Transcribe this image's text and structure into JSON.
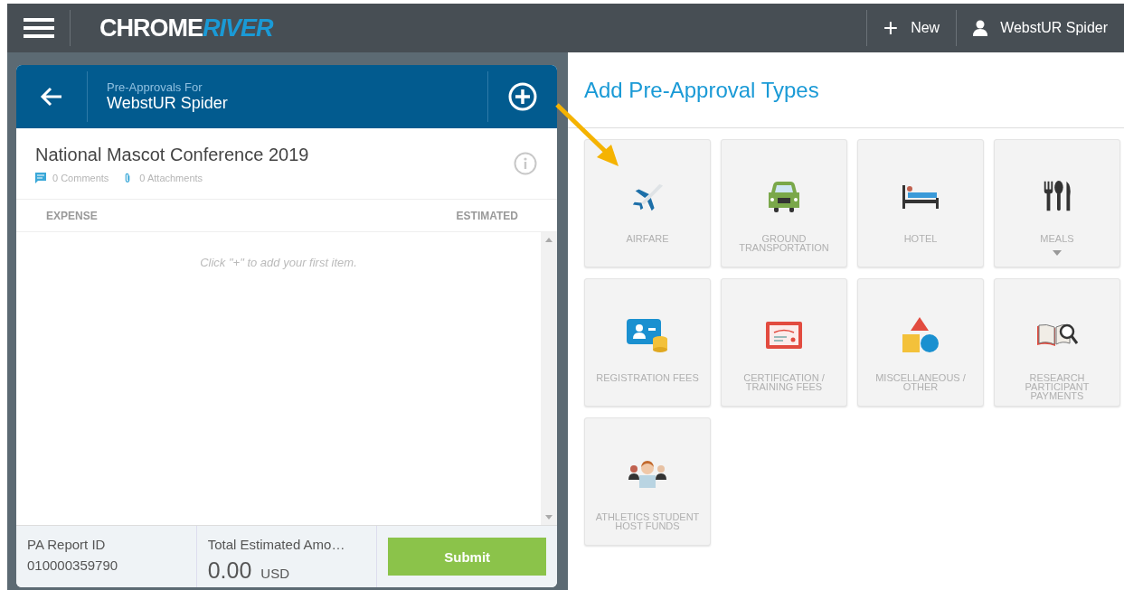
{
  "top_bar": {
    "logo": {
      "part_1": "CHROME",
      "part_2": "RIVER"
    },
    "new_button": {
      "icon": "+",
      "label": "New"
    },
    "user": "WebstUR Spider"
  },
  "panel": {
    "header": {
      "caption": "Pre-Approvals For",
      "name": "WebstUR Spider"
    },
    "report": {
      "title": "National Mascot Conference 2019",
      "comments": "0 Comments",
      "attachments": "0 Attachments"
    },
    "columns": [
      "EXPENSE",
      "ESTIMATED"
    ],
    "empty_hint": "Click \"+\" to add your first item.",
    "footer": {
      "id_label": "PA Report ID",
      "id_value": "010000359790",
      "total_label": "Total Estimated Amo…",
      "total_value": "0.00",
      "currency": "USD",
      "submit": "Submit"
    }
  },
  "types": {
    "title": "Add Pre-Approval Types",
    "tiles": [
      {
        "kind": "airfare",
        "label": "AIRFARE",
        "has_menu": false
      },
      {
        "kind": "ground",
        "label": "GROUND TRANSPORTATION",
        "has_menu": false
      },
      {
        "kind": "hotel",
        "label": "HOTEL",
        "has_menu": false
      },
      {
        "kind": "meals",
        "label": "MEALS",
        "has_menu": true
      },
      {
        "kind": "registration",
        "label": "REGISTRATION FEES",
        "has_menu": false
      },
      {
        "kind": "certification",
        "label": "CERTIFICATION / TRAINING FEES",
        "has_menu": false
      },
      {
        "kind": "misc",
        "label": "MISCELLANEOUS / OTHER",
        "has_menu": false
      },
      {
        "kind": "research",
        "label": "RESEARCH PARTICIPANT PAYMENTS",
        "has_menu": false
      },
      {
        "kind": "athletics",
        "label": "ATHLETICS STUDENT HOST FUNDS",
        "has_menu": false
      }
    ]
  }
}
